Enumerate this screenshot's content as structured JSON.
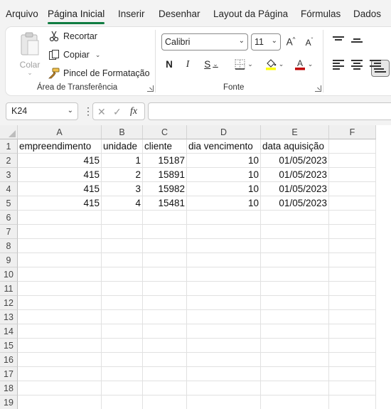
{
  "tabs": [
    "Arquivo",
    "Página Inicial",
    "Inserir",
    "Desenhar",
    "Layout da Página",
    "Fórmulas",
    "Dados"
  ],
  "active_tab": "Página Inicial",
  "clipboard": {
    "paste_label": "Colar",
    "cut_label": "Recortar",
    "copy_label": "Copiar",
    "format_painter_label": "Pincel de Formatação",
    "group_label": "Área de Transferência"
  },
  "font": {
    "family": "Calibri",
    "size": "11",
    "bold": "N",
    "italic": "I",
    "underline": "S",
    "group_label": "Fonte",
    "fill_color": "#ffff00",
    "text_color": "#c00000"
  },
  "formula_bar": {
    "name_box": "K24",
    "fx_label": "fx",
    "formula": ""
  },
  "grid": {
    "columns": [
      "A",
      "B",
      "C",
      "D",
      "E",
      "F"
    ],
    "rows": [
      "1",
      "2",
      "3",
      "4",
      "5",
      "6",
      "7",
      "8",
      "9",
      "10",
      "11",
      "12",
      "13",
      "14",
      "15",
      "16",
      "17",
      "18",
      "19"
    ],
    "headers": [
      "empreendimento",
      "unidade",
      "cliente",
      "dia vencimento",
      "data aquisição"
    ],
    "data": [
      [
        "415",
        "1",
        "15187",
        "10",
        "01/05/2023"
      ],
      [
        "415",
        "2",
        "15891",
        "10",
        "01/05/2023"
      ],
      [
        "415",
        "3",
        "15982",
        "10",
        "01/05/2023"
      ],
      [
        "415",
        "4",
        "15481",
        "10",
        "01/05/2023"
      ]
    ]
  },
  "colors": {
    "accent": "#107c41"
  }
}
